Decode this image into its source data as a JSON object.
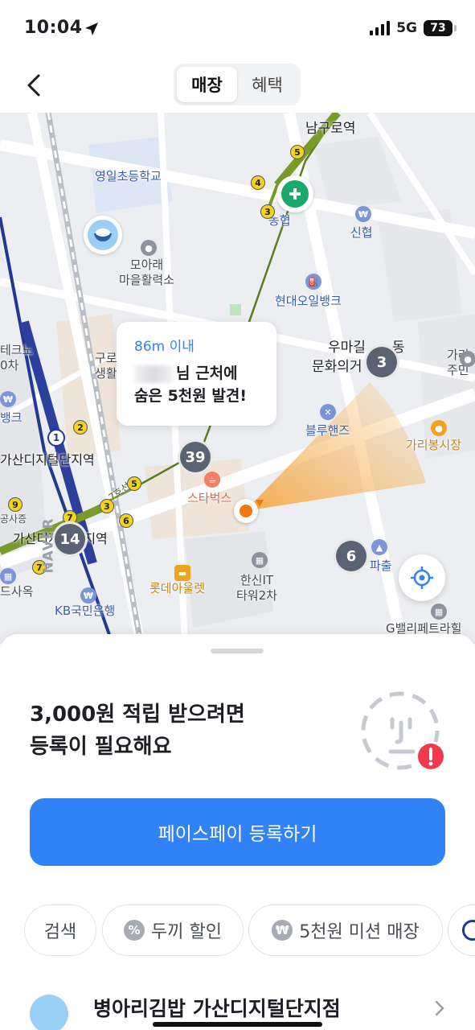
{
  "status": {
    "time": "10:04",
    "network": "5G",
    "battery": "73"
  },
  "header": {
    "tabs": [
      {
        "label": "매장",
        "active": true
      },
      {
        "label": "혜택",
        "active": false
      }
    ]
  },
  "map": {
    "labels": {
      "namgurostation": "남구로역",
      "school": "영일초등학교",
      "nonghyup": "농협",
      "shinhan": "신협",
      "moarae": "모아래\n마을활력소",
      "hyundaioil": "현대오일뱅크",
      "guro": "구로공\n생활",
      "umagil": "우마길",
      "munhwa": "문화의거",
      "dong": "동",
      "garibong_left": "가리-\n주민",
      "bluehands": "블루핸즈",
      "garibong_market": "가리봉시장",
      "gasan_station": "가산디지털단지역",
      "gasan_station2": "가산디지털단지역",
      "starbucks": "스타벅스",
      "lotte": "롯데아울렛",
      "hanshin": "한신IT\n타워2차",
      "kb": "KB국민은행",
      "pacheul": "파출",
      "gvalley": "G밸리페트라힐",
      "tekno": "테크노\n0차",
      "bank": "뱅크",
      "gongsa": "공사증",
      "dsa": "드사옥",
      "line_label": "7호선"
    },
    "clusters": {
      "c1": "3",
      "c2": "39",
      "c3": "14",
      "c4": "6"
    },
    "bubble": {
      "distance": "86m 이내",
      "line1": "님 근처에",
      "line2": "숨은 5천원 발견!"
    },
    "watermark": "NAVER"
  },
  "sheet": {
    "promo_line1": "3,000원 적립 받으려면",
    "promo_line2": "등록이 필요해요",
    "cta_label": "페이스페이 등록하기",
    "chips": [
      {
        "label": "검색",
        "icon": ""
      },
      {
        "label": "두끼 할인",
        "icon": "%"
      },
      {
        "label": "5천원 미션 매장",
        "icon": "₩"
      }
    ],
    "store_name": "병아리김밥 가산디지털단지점"
  },
  "colors": {
    "accent": "#3182f6",
    "subway_green": "#5b7d1e",
    "subway_blue": "#1f3a93",
    "me_orange": "#ee7a0d"
  }
}
